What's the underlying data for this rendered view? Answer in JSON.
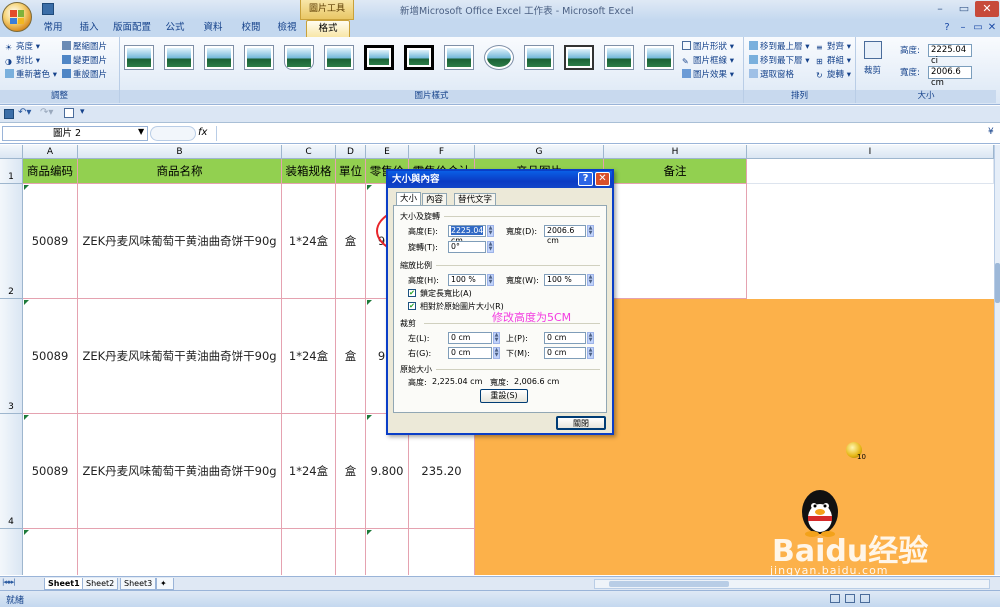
{
  "window": {
    "title": "新增Microsoft Office Excel 工作表 - Microsoft Excel",
    "context_tab_group": "圖片工具"
  },
  "tabs": [
    "常用",
    "插入",
    "版面配置",
    "公式",
    "資料",
    "校閱",
    "檢視",
    "格式"
  ],
  "ribbon": {
    "adjust": {
      "label": "調整",
      "items": [
        "亮度",
        "壓縮圖片",
        "對比",
        "變更圖片",
        "重新著色",
        "重設圖片"
      ]
    },
    "styles": {
      "label": "圖片樣式",
      "items": [
        "圖片形狀",
        "圖片框線",
        "圖片效果"
      ]
    },
    "arrange": {
      "label": "排列",
      "items": [
        "移到最上層",
        "對齊",
        "移到最下層",
        "群組",
        "選取窗格",
        "旋轉"
      ]
    },
    "size": {
      "label": "大小",
      "crop": "裁剪",
      "height_label": "高度:",
      "height_value": "2225.04 ci",
      "width_label": "寬度:",
      "width_value": "2006.6 cm"
    }
  },
  "formula_bar": {
    "name_box": "圖片 2",
    "fx": "fx"
  },
  "columns": [
    "A",
    "B",
    "C",
    "D",
    "E",
    "F",
    "G",
    "H",
    "I"
  ],
  "rows": [
    "1",
    "2",
    "3",
    "4"
  ],
  "headers": {
    "A": "商品编码",
    "B": "商品名称",
    "C": "装箱规格",
    "D": "單位",
    "E": "零售价",
    "F": "零售价合计",
    "G": "产品图片",
    "H": "备注"
  },
  "data_rows": [
    {
      "code": "50089",
      "name": "ZEK丹麦风味葡萄干黄油曲奇饼干90g",
      "spec": "1*24盒",
      "unit": "盒",
      "price": "9.8",
      "total": ""
    },
    {
      "code": "50089",
      "name": "ZEK丹麦风味葡萄干黄油曲奇饼干90g",
      "spec": "1*24盒",
      "unit": "盒",
      "price": "9.8",
      "total": ""
    },
    {
      "code": "50089",
      "name": "ZEK丹麦风味葡萄干黄油曲奇饼干90g",
      "spec": "1*24盒",
      "unit": "盒",
      "price": "9.800",
      "total": "235.20"
    }
  ],
  "dialog": {
    "title": "大小與內容",
    "tabs": [
      "大小",
      "內容",
      "替代文字"
    ],
    "section_size": "大小及旋轉",
    "height_label": "高度(E):",
    "height_value": "2225.04",
    "height_unit": "cm",
    "width_label": "寬度(D):",
    "width_value": "2006.6 cm",
    "rotate_label": "旋轉(T):",
    "rotate_value": "0°",
    "section_scale": "縮放比例",
    "scale_h_label": "高度(H):",
    "scale_h_value": "100 %",
    "scale_w_label": "寬度(W):",
    "scale_w_value": "100 %",
    "lock_aspect": "鎖定長寬比(A)",
    "relative_original": "相對於原始圖片大小(R)",
    "section_crop": "裁剪",
    "crop_left_label": "左(L):",
    "crop_left": "0 cm",
    "crop_top_label": "上(P):",
    "crop_top": "0 cm",
    "crop_right_label": "右(G):",
    "crop_right": "0 cm",
    "crop_bottom_label": "下(M):",
    "crop_bottom": "0 cm",
    "section_original": "原始大小",
    "orig_height_label": "高度:",
    "orig_height": "2,225.04 cm",
    "orig_width_label": "寬度:",
    "orig_width": "2,006.6 cm",
    "reset_button": "重設(S)",
    "close_button": "關閉"
  },
  "annotation": {
    "text": "修改高度为5CM",
    "color": "#f33ce0"
  },
  "sheets": [
    "Sheet1",
    "Sheet2",
    "Sheet3"
  ],
  "status": {
    "left": "就緒"
  },
  "watermark": {
    "brand": "Baidu经验",
    "url": "jingyan.baidu.com",
    "badge": "10"
  },
  "colors": {
    "header_green": "#92d050",
    "image_orange": "#fcb14a",
    "accent_blue": "#0a3ec7"
  }
}
